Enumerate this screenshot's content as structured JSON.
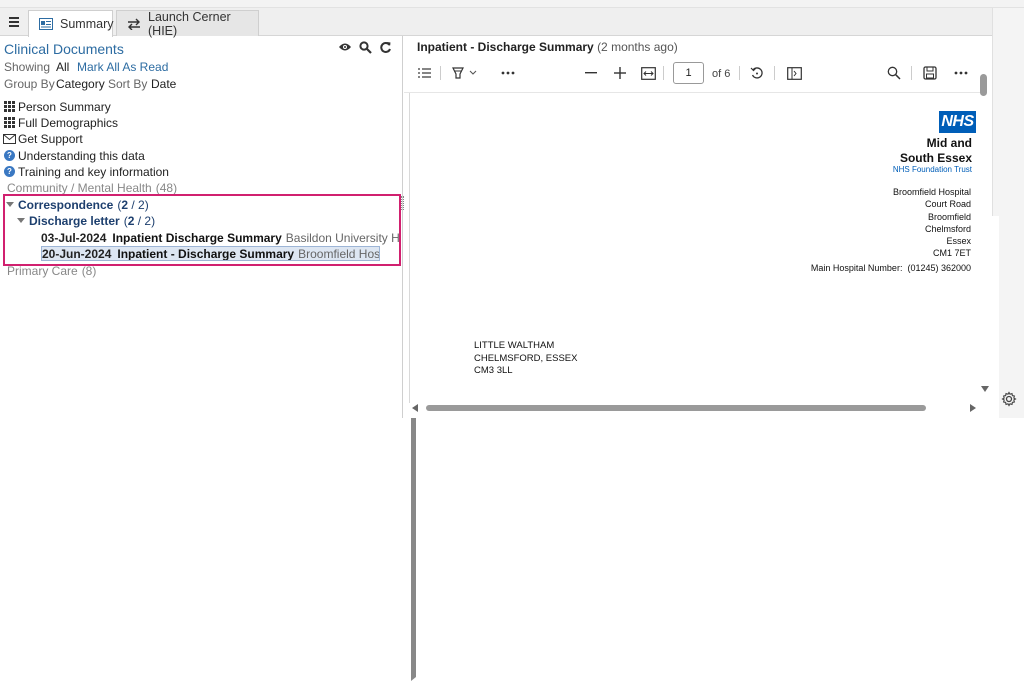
{
  "tabs": [
    {
      "label": "Summary",
      "icon": "summary-doc-icon",
      "active": true
    },
    {
      "label": "Launch Cerner (HIE)",
      "icon": "swap-arrows-icon",
      "active": false
    }
  ],
  "left": {
    "title": "Clinical Documents",
    "showing_label": "Showing",
    "showing_value": "All",
    "mark_all_link": "Mark All As Read",
    "group_by_label": "Group By",
    "group_by_value": "Category",
    "sort_by_label": "Sort By",
    "sort_by_value": "Date",
    "nav": [
      {
        "label": "Person Summary",
        "icon": "grid-icon"
      },
      {
        "label": "Full Demographics",
        "icon": "grid-icon"
      },
      {
        "label": "Get Support",
        "icon": "envelope-icon"
      },
      {
        "label": "Understanding this data",
        "icon": "help-icon"
      },
      {
        "label": "Training and key information",
        "icon": "help-icon"
      }
    ],
    "tree": {
      "community": {
        "label": "Community / Mental Health",
        "count": "(48)"
      },
      "correspondence": {
        "label": "Correspondence",
        "count_open": "(",
        "count_unread": "2",
        "count_rest": " / 2)"
      },
      "discharge": {
        "label": "Discharge letter",
        "count_open": "(",
        "count_unread": "2",
        "count_rest": " / 2)"
      },
      "docs": [
        {
          "date": "03-Jul-2024",
          "title": "Inpatient Discharge Summary",
          "site": "Basildon University Hospital",
          "selected": false
        },
        {
          "date": "20-Jun-2024",
          "title": "Inpatient - Discharge Summary",
          "site": "Broomfield Hospital",
          "selected": true
        }
      ],
      "primary": {
        "label": "Primary Care",
        "count": "(8)"
      }
    }
  },
  "viewer": {
    "title": "Inpatient - Discharge Summary",
    "age": "(2 months ago)",
    "page_current": "1",
    "page_total_label": "of 6",
    "letter": {
      "nhs_logo": "NHS",
      "trust_name_line1": "Mid and",
      "trust_name_line2": "South Essex",
      "trust_subtitle": "NHS Foundation Trust",
      "address": [
        "Broomfield Hospital",
        "Court Road",
        "Broomfield",
        "Chelmsford",
        "Essex",
        "CM1 7ET"
      ],
      "main_number": "Main Hospital Number:  (01245) 362000",
      "recipient": [
        "LITTLE WALTHAM",
        "CHELMSFORD, ESSEX",
        "CM3 3LL"
      ]
    }
  },
  "colors": {
    "accent": "#2d6ca2",
    "highlight": "#d1206f",
    "nhs_blue": "#005eb8",
    "navy": "#1d3f6e"
  }
}
